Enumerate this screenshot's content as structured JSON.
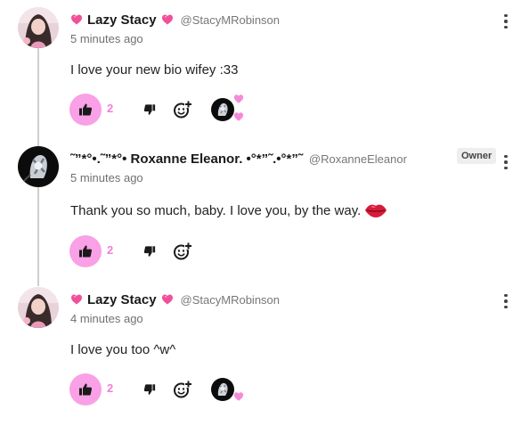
{
  "colors": {
    "like_bg": "#f9a0e6",
    "accent_pink": "#f080d8",
    "heart_pink": "#f0509a",
    "thread_line": "#cfcfcf"
  },
  "comments": [
    {
      "display_name": "Lazy Stacy",
      "handle": "@StacyMRobinson",
      "timestamp": "5 minutes ago",
      "text": "I love your new bio wifey :33",
      "likes": "2",
      "name_decoration_icon": "pink-heart-icon",
      "creator_hearted": true
    },
    {
      "display_name": "˜”*°•.˜”*°• Roxanne Eleanor. •°*”˜.•°*”˜",
      "handle": "@RoxanneEleanor",
      "badge": "Owner",
      "timestamp": "5 minutes ago",
      "text": "Thank you so much, baby. I love you, by the way.",
      "text_emoji_icon": "lips-emoji-icon",
      "likes": "2",
      "creator_hearted": false
    },
    {
      "display_name": "Lazy Stacy",
      "handle": "@StacyMRobinson",
      "timestamp": "4 minutes ago",
      "text": "I love you too ^w^",
      "likes": "2",
      "name_decoration_icon": "pink-heart-icon",
      "creator_hearted": true
    }
  ]
}
